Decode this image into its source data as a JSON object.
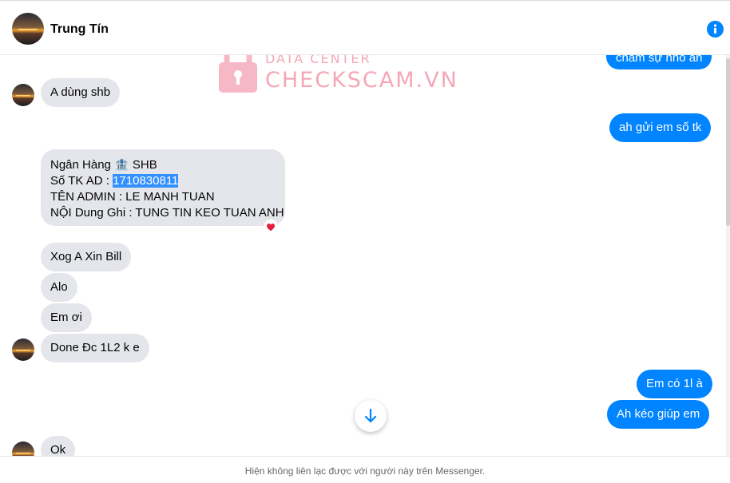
{
  "header": {
    "contact_name": "Trung Tín"
  },
  "watermark": {
    "top": "DATA CENTER",
    "main": "CHECKSCAM.VN"
  },
  "messages": {
    "m1": "chăm sự nho ah",
    "m2": "A dùng shb",
    "m3": "ah gửi em số tk",
    "bank": {
      "line1": "Ngân Hàng 🏦 SHB",
      "line2_prefix": "Số TK AD : ",
      "line2_number": "1710830811",
      "line3": "TÊN ADMIN : LE MANH TUAN",
      "line4": "NỘI Dung Ghi : TUNG TIN KEO TUAN ANH"
    },
    "m5": "Xog A Xin Bill",
    "m6": "Alo",
    "m7": "Em ơi",
    "m8": "Done Đc 1L2 k e",
    "m9": "Em có 1l à",
    "m10": "Ah kéo giúp em",
    "m11": "Ok"
  },
  "reaction": "heart-icon",
  "icons": {
    "info": "info-icon",
    "scroll_down": "arrow-down-icon"
  },
  "footer": {
    "notice": "Hiện không liên lạc được với người này trên Messenger."
  },
  "colors": {
    "accent": "#0084ff",
    "incoming": "#e4e6eb",
    "watermark": "#f4a7b9",
    "heart": "#e41e3f"
  }
}
